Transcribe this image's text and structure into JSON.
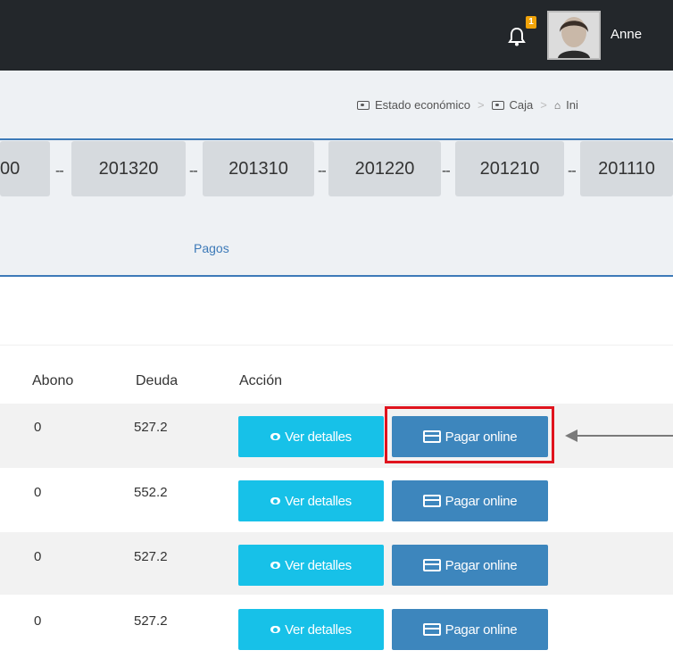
{
  "header": {
    "notification_count": "1",
    "username": "Anne"
  },
  "breadcrumb": {
    "items": [
      "Estado económico",
      "Caja",
      "Ini"
    ]
  },
  "periods": [
    "00",
    "201320",
    "201310",
    "201220",
    "201210",
    "201110"
  ],
  "section_link": "Pagos",
  "table": {
    "headers": [
      "Abono",
      "Deuda",
      "Acción"
    ],
    "rows": [
      {
        "abono": "0",
        "deuda": "527.2"
      },
      {
        "abono": "0",
        "deuda": "552.2"
      },
      {
        "abono": "0",
        "deuda": "527.2"
      },
      {
        "abono": "0",
        "deuda": "527.2"
      }
    ],
    "actions": {
      "view_label": "Ver detalles",
      "pay_label": "Pagar online"
    }
  },
  "colors": {
    "topbar": "#23272b",
    "view_button": "#17c1e8",
    "pay_button": "#3d86bd",
    "highlight": "#e0141e",
    "accent": "#3d7ab8"
  }
}
